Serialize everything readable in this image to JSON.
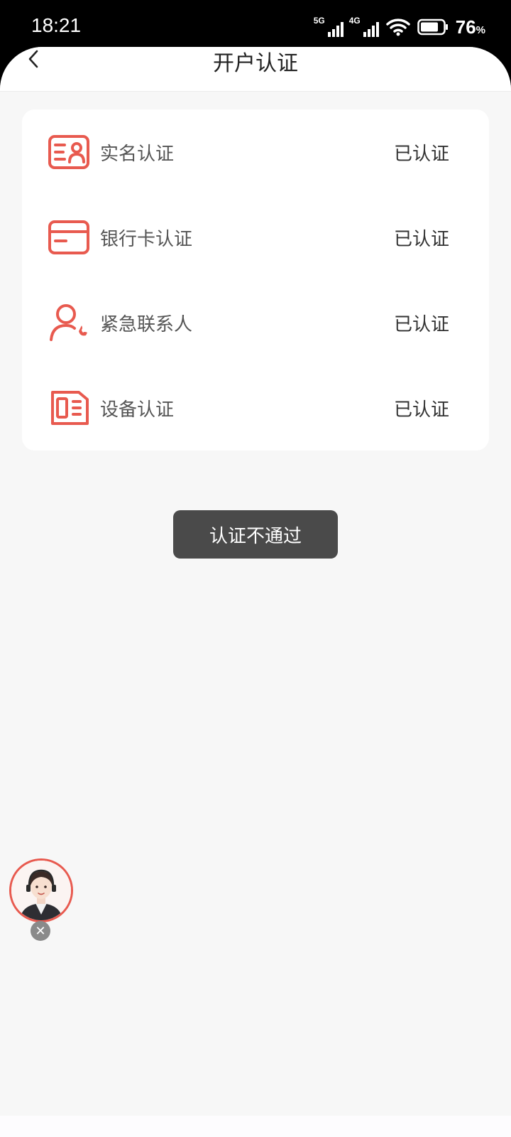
{
  "status_bar": {
    "time": "18:21",
    "net1": "5G",
    "net2": "4G",
    "battery": "76",
    "battery_unit": "%"
  },
  "header": {
    "title": "开户认证",
    "back_icon": "chevron-left-icon"
  },
  "verification_items": [
    {
      "label": "实名认证",
      "status": "已认证",
      "icon": "id-card-icon"
    },
    {
      "label": "银行卡认证",
      "status": "已认证",
      "icon": "bank-card-icon"
    },
    {
      "label": "紧急联系人",
      "status": "已认证",
      "icon": "contact-phone-icon"
    },
    {
      "label": "设备认证",
      "status": "已认证",
      "icon": "device-icon"
    }
  ],
  "toast": {
    "message": "认证不通过"
  },
  "support": {
    "avatar_icon": "customer-service-avatar-icon",
    "close_icon": "close-icon"
  },
  "colors": {
    "accent": "#e85a4f",
    "background": "#f7f7f7",
    "toast_bg": "#4a4a4a"
  }
}
